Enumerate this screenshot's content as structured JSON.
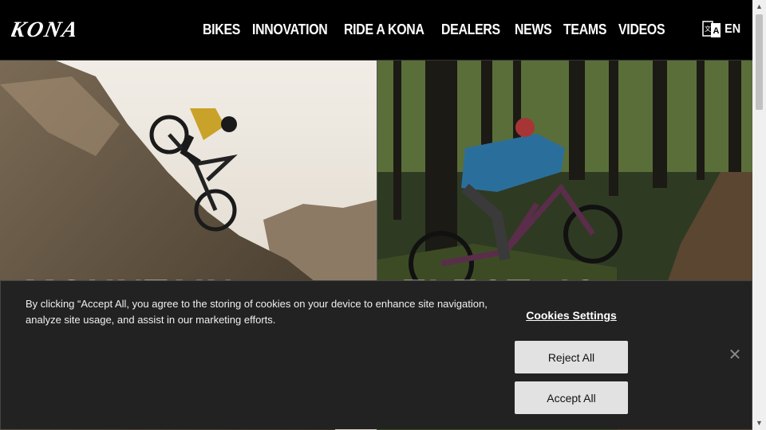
{
  "header": {
    "logo_text": "KONA",
    "nav": [
      "BIKES",
      "INNOVATION",
      "RIDE A KONA",
      "DEALERS",
      "NEWS",
      "TEAMS",
      "VIDEOS"
    ],
    "language": "EN"
  },
  "hero": {
    "left_title": "MOUNTAIN",
    "right_title": "ELECTRIC"
  },
  "cookie": {
    "text": "By clicking “Accept All, you agree to the storing of cookies on your device to enhance site navigation, analyze site usage, and assist in our marketing efforts.",
    "settings_label": "Cookies Settings",
    "reject_label": "Reject All",
    "accept_label": "Accept All",
    "close_glyph": "✕"
  },
  "colors": {
    "header_bg": "#000000",
    "banner_bg": "#222222",
    "button_bg": "#e2e2e2"
  }
}
